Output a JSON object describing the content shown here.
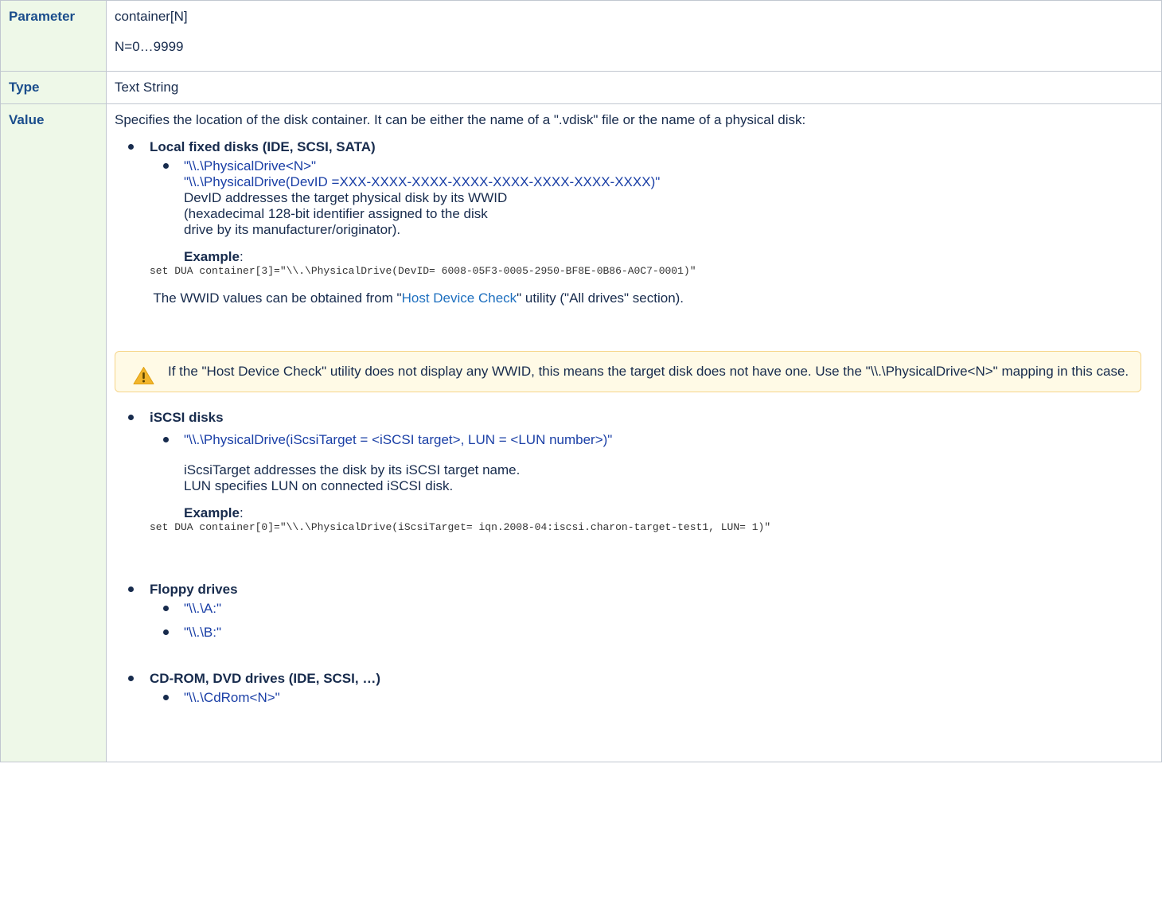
{
  "rows": {
    "parameter": {
      "header": "Parameter",
      "lines": [
        "container[N]",
        "N=0…9999"
      ]
    },
    "type": {
      "header": "Type",
      "text": "Text String"
    },
    "value": {
      "header": "Value",
      "intro": "Specifies the location of the disk container. It can be either the name of a \".vdisk\" file or the name of a physical disk:",
      "local": {
        "title": "Local fixed disks (IDE, SCSI, SATA)",
        "path1": "\"\\\\.\\PhysicalDrive<N>\"",
        "path2": "\"\\\\.\\PhysicalDrive(DevID =XXX-XXXX-XXXX-XXXX-XXXX-XXXX-XXXX-XXXX)\"",
        "desc1": "DevID addresses the target physical disk by its WWID",
        "desc2": "(hexadecimal 128-bit identifier assigned to the disk",
        "desc3": "drive by its manufacturer/originator).",
        "example_label": "Example",
        "example_colon": ":",
        "example_code": "set DUA container[3]=\"\\\\.\\PhysicalDrive(DevID= 6008-05F3-0005-2950-BF8E-0B86-A0C7-0001)\"",
        "wwid_pre": " The WWID values can be obtained from \"",
        "wwid_link": "Host Device Check",
        "wwid_post": "\" utility (\"All drives\" section).",
        "warning": "If the \"Host Device Check\" utility does not display any WWID, this means the target disk does not have one. Use the \"\\\\.\\PhysicalDrive<N>\" mapping in this case."
      },
      "iscsi": {
        "title": "iSCSI disks",
        "path": "\"\\\\.\\PhysicalDrive(iScsiTarget = <iSCSI target>, LUN = <LUN number>)\"",
        "desc1": "iScsiTarget addresses the disk by its iSCSI target name.",
        "desc2": "LUN specifies LUN on connected iSCSI disk.",
        "example_label": "Example",
        "example_colon": ":",
        "example_code": "set DUA container[0]=\"\\\\.\\PhysicalDrive(iScsiTarget= iqn.2008-04:iscsi.charon-target-test1, LUN= 1)\""
      },
      "floppy": {
        "title": "Floppy drives",
        "a": "\"\\\\.\\A:\"",
        "b": "\"\\\\.\\B:\""
      },
      "cdrom": {
        "title": "CD-ROM, DVD drives (IDE, SCSI, …)",
        "path": "\"\\\\.\\CdRom<N>\""
      }
    }
  },
  "colors": {
    "header_bg": "#eef8e8",
    "header_text": "#1a4d8c",
    "path_text": "#1a3fa6",
    "link": "#1d6fbf",
    "warning_bg": "#fffae6",
    "warning_border": "#f6d58a"
  },
  "icons": {
    "warning": "warning-triangle-icon"
  }
}
